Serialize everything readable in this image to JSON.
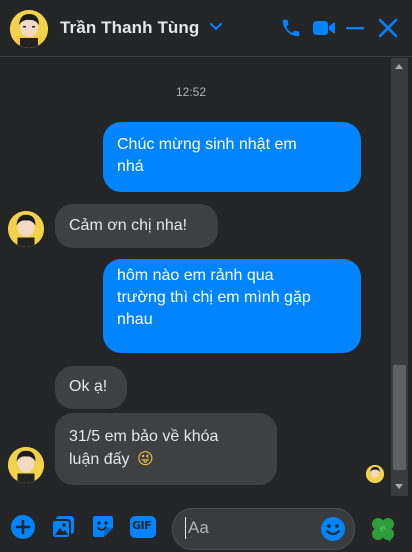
{
  "header": {
    "contact_name": "Trần Thanh Tùng",
    "icons": [
      "avatar",
      "chevron-down-icon",
      "phone-icon",
      "video-icon",
      "minimize-icon",
      "close-icon"
    ]
  },
  "thread": {
    "timestamp": "12:52",
    "messages": [
      {
        "direction": "outgoing",
        "lines": [
          "Chúc mừng sinh nhật em",
          "nhá"
        ]
      },
      {
        "direction": "incoming",
        "lines": [
          "Cảm ơn chị nha!"
        ]
      },
      {
        "direction": "outgoing",
        "lines": [
          "hôm nào em rảnh qua",
          "trường thì chị em mình gặp",
          "nhau"
        ]
      },
      {
        "direction": "incoming",
        "lines": [
          "Ok ạ!"
        ]
      },
      {
        "direction": "incoming",
        "lines": [
          "31/5 em bảo về khóa",
          "luận đấy"
        ],
        "emoji": "😜"
      }
    ]
  },
  "composer": {
    "placeholder": "Aa",
    "icons": [
      "plus-icon",
      "image-icon",
      "sticker-icon",
      "gif-icon",
      "emoji-icon",
      "clover-icon"
    ],
    "gif_label": "GIF"
  },
  "colors": {
    "accent": "#0084ff",
    "background": "#242526",
    "incoming_bubble": "#3e4042",
    "clover": "#2e9e3a"
  }
}
